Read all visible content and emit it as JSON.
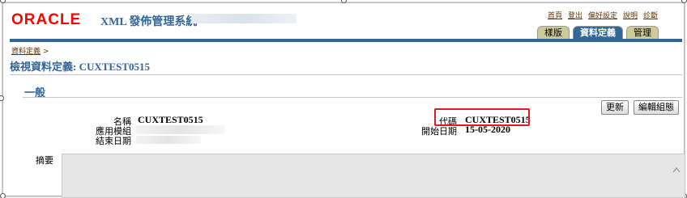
{
  "logo": "ORACLE",
  "app_title": "XML 發佈管理系統",
  "global_links": [
    "首頁",
    "登出",
    "偏好設定",
    "說明",
    "診斷"
  ],
  "tabs": [
    "樣版",
    "資料定義",
    "管理"
  ],
  "breadcrumb": {
    "link": "資料定義",
    "separator": ">"
  },
  "page_title": "檢視資料定義: CUXTEST0515",
  "section_title": "一般",
  "buttons": {
    "update": "更新",
    "edit_config": "編輯組態"
  },
  "fields": {
    "name_label": "名稱",
    "name_value": "CUXTEST0515",
    "app_label": "應用模組",
    "end_label": "結束日期",
    "code_label": "代碼",
    "code_value": "CUXTEST0515",
    "start_label": "開始日期",
    "start_value": "15-05-2020",
    "summary_label": "摘要"
  },
  "colors": {
    "brand": "#ff0000",
    "accent": "#336699",
    "highlight": "#e3191b"
  }
}
